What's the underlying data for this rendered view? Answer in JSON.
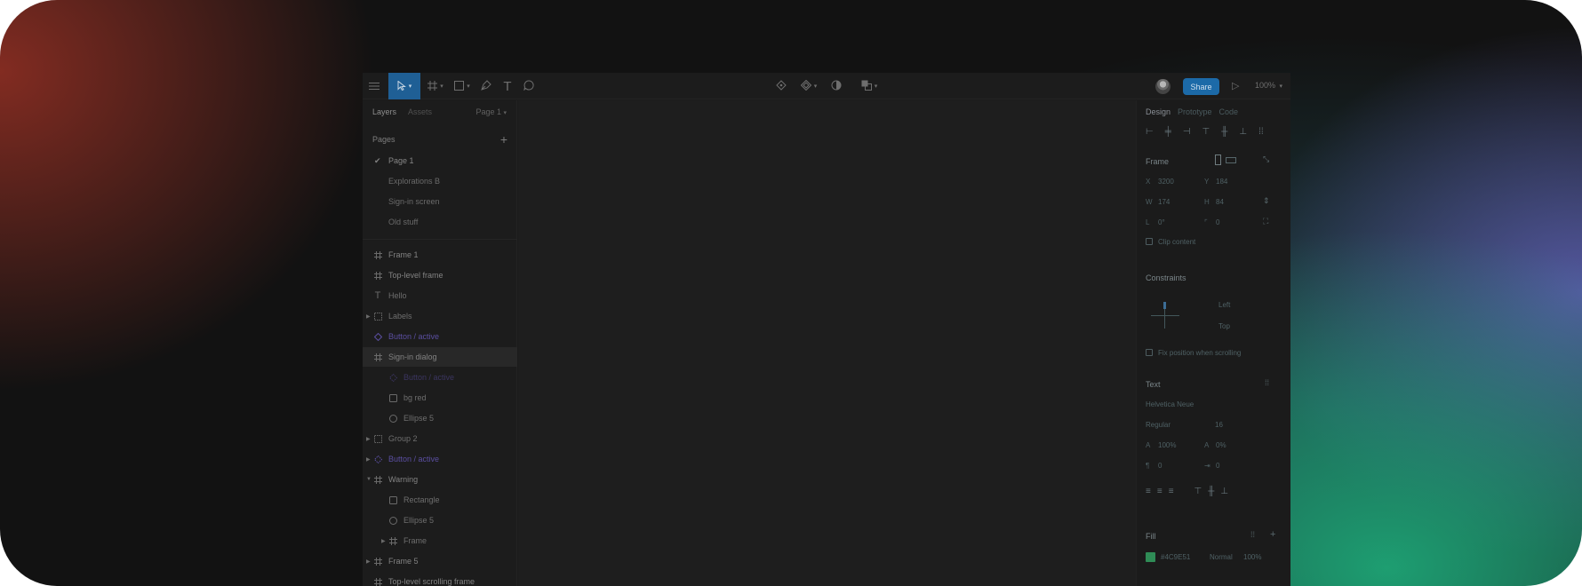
{
  "toolbar": {
    "menu_icon": "hamburger-icon",
    "tools": [
      {
        "name": "move-tool",
        "icon": "cursor-icon",
        "active": true
      },
      {
        "name": "frame-tool",
        "icon": "frame-icon"
      },
      {
        "name": "shape-tool",
        "icon": "rectangle-icon"
      },
      {
        "name": "pen-tool",
        "icon": "pen-icon"
      },
      {
        "name": "text-tool",
        "icon": "text-icon",
        "glyph": "T"
      },
      {
        "name": "comment-tool",
        "icon": "comment-icon"
      }
    ],
    "center_tools": [
      "edit-object-icon",
      "component-icon",
      "mask-icon",
      "boolean-icon"
    ],
    "share_label": "Share",
    "zoom_label": "100%"
  },
  "left_panel": {
    "tabs": [
      "Layers",
      "Assets"
    ],
    "page_selector": "Page 1",
    "pages_heading": "Pages",
    "pages": [
      {
        "label": "Page 1",
        "selected": true
      },
      {
        "label": "Explorations B",
        "selected": false
      },
      {
        "label": "Sign-in screen",
        "selected": false
      },
      {
        "label": "Old stuff",
        "selected": false
      }
    ],
    "layers": [
      {
        "label": "Frame 1",
        "icon": "frame",
        "indent": 0,
        "bold": true
      },
      {
        "label": "Top-level frame",
        "icon": "frame",
        "indent": 0,
        "bold": true
      },
      {
        "label": "Hello",
        "icon": "text",
        "indent": 0
      },
      {
        "label": "Labels",
        "icon": "group",
        "indent": 0,
        "expander": true
      },
      {
        "label": "Button / active",
        "icon": "component",
        "indent": 0,
        "component": true,
        "bold": true
      },
      {
        "label": "Sign-in dialog",
        "icon": "frame",
        "indent": 0,
        "bold": true,
        "highlight": true
      },
      {
        "label": "Button / active",
        "icon": "instance",
        "indent": 1,
        "component_dim": true
      },
      {
        "label": "bg red",
        "icon": "rect",
        "indent": 1
      },
      {
        "label": "Ellipse 5",
        "icon": "ellipse",
        "indent": 1
      },
      {
        "label": "Group 2",
        "icon": "group",
        "indent": 0,
        "expander": true
      },
      {
        "label": "Button / active",
        "icon": "instance",
        "indent": 0,
        "expander": true,
        "component": true
      },
      {
        "label": "Warning",
        "icon": "frame",
        "indent": 0,
        "bold": true,
        "expanded": true
      },
      {
        "label": "Rectangle",
        "icon": "rect",
        "indent": 1
      },
      {
        "label": "Ellipse 5",
        "icon": "ellipse",
        "indent": 1
      },
      {
        "label": "Frame",
        "icon": "frame",
        "indent": 1,
        "expander": true
      },
      {
        "label": "Frame 5",
        "icon": "frame",
        "indent": 0,
        "bold": true,
        "expander": true
      },
      {
        "label": "Top-level scrolling frame",
        "icon": "frame",
        "indent": 0,
        "bold": true
      }
    ]
  },
  "right_panel": {
    "tabs": [
      "Design",
      "Prototype",
      "Code"
    ],
    "frame": {
      "heading": "Frame",
      "x_label": "X",
      "x_value": "3200",
      "y_label": "Y",
      "y_value": "184",
      "w_label": "W",
      "w_value": "174",
      "h_label": "H",
      "h_value": "84",
      "r_label": "L",
      "r_value": "0°",
      "c_label": "⌜",
      "c_value": "0",
      "clip_label": "Clip content"
    },
    "constraints": {
      "heading": "Constraints",
      "horizontal": "Left",
      "vertical": "Top",
      "fix_label": "Fix position when scrolling"
    },
    "text": {
      "heading": "Text",
      "font": "Helvetica Neue",
      "weight": "Regular",
      "size": "16",
      "line_height": "100%",
      "letter_spacing": "0%",
      "para_spacing": "0",
      "para_indent": "0"
    },
    "fill": {
      "heading": "Fill",
      "hex": "#4C9E51",
      "opacity": "100%",
      "blend": "Normal",
      "color": "#2f8c56"
    }
  }
}
